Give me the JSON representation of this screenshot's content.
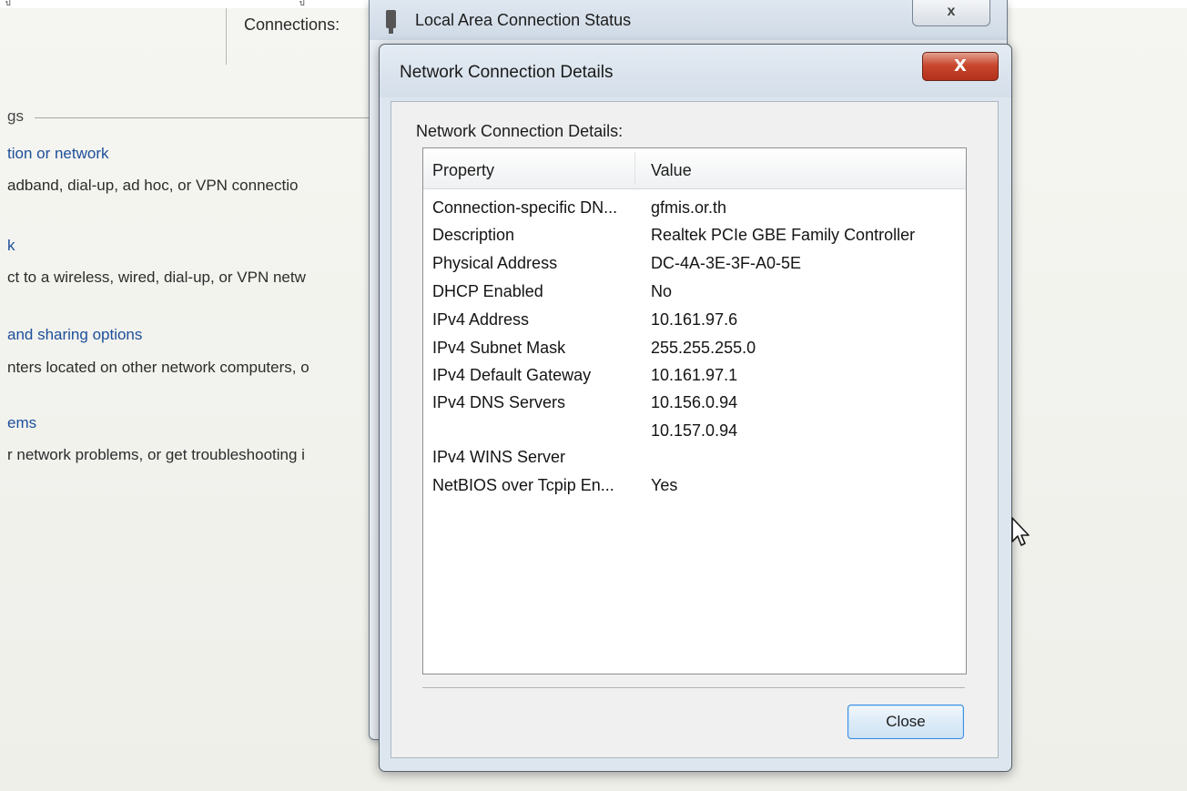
{
  "top_strip": {
    "marks": [
      "ป",
      "ป"
    ]
  },
  "background_panel": {
    "connections_label": "Connections:",
    "section_title": "gs",
    "items": [
      {
        "link": "tion or network",
        "desc": "adband, dial-up, ad hoc, or VPN connectio"
      },
      {
        "link": "k",
        "desc": "ct to a wireless, wired, dial-up, or VPN netw"
      },
      {
        "link": "and sharing options",
        "desc": "nters located on other network computers, o"
      },
      {
        "link": "ems",
        "desc": "r network problems, or get troubleshooting i"
      }
    ]
  },
  "status_window": {
    "title": "Local Area Connection Status",
    "close_label": "x"
  },
  "dialog": {
    "title": "Network Connection Details",
    "close_label": "X",
    "details_label": "Network Connection Details:",
    "columns": {
      "property": "Property",
      "value": "Value"
    },
    "rows": [
      {
        "property": "Connection-specific DN...",
        "value": "gfmis.or.th"
      },
      {
        "property": "Description",
        "value": "Realtek PCIe GBE Family Controller"
      },
      {
        "property": "Physical Address",
        "value": "DC-4A-3E-3F-A0-5E"
      },
      {
        "property": "DHCP Enabled",
        "value": "No"
      },
      {
        "property": "IPv4 Address",
        "value": "10.161.97.6"
      },
      {
        "property": "IPv4 Subnet Mask",
        "value": "255.255.255.0"
      },
      {
        "property": "IPv4 Default Gateway",
        "value": "10.161.97.1"
      },
      {
        "property": "IPv4 DNS Servers",
        "value": "10.156.0.94"
      },
      {
        "property": "",
        "value": "10.157.0.94"
      },
      {
        "property": "IPv4 WINS Server",
        "value": ""
      },
      {
        "property": "NetBIOS over Tcpip En...",
        "value": "Yes"
      }
    ],
    "close_button_label": "Close"
  },
  "colors": {
    "link": "#1d4f9a",
    "close_button_red": "#c9472f",
    "focused_button_border": "#3d8ee0"
  },
  "icons": [
    "network-adapter-icon",
    "mouse-cursor-icon"
  ]
}
